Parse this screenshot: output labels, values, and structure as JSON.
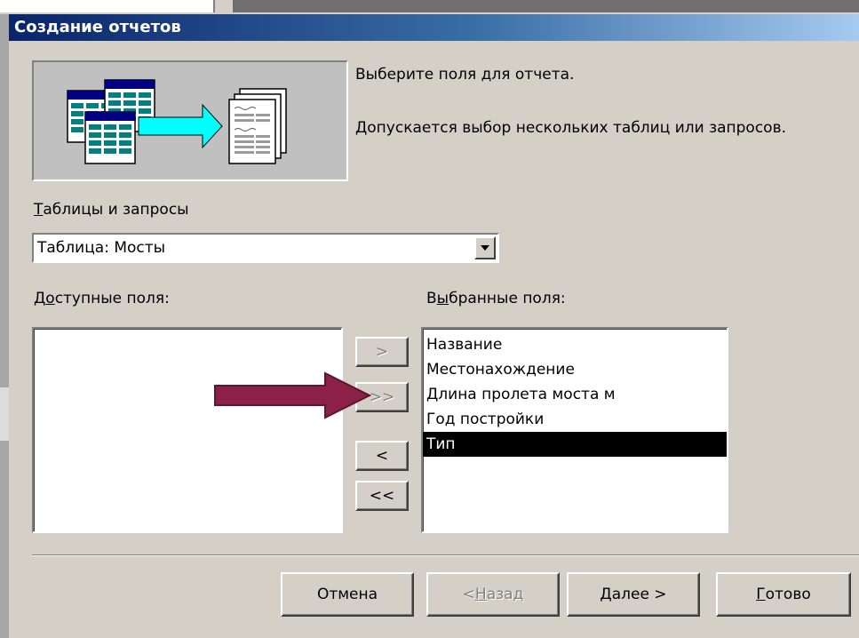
{
  "window": {
    "title": "Создание отчетов"
  },
  "intro": {
    "line1": "Выберите поля для отчета.",
    "line2": "Допускается выбор нескольких таблиц или запросов."
  },
  "tables": {
    "label_hotkey": "Т",
    "label_rest": "аблицы и запросы",
    "selected": "Таблица: Мосты"
  },
  "available": {
    "label_pre": "Д",
    "label_hotkey": "о",
    "label_rest": "ступные поля:",
    "items": []
  },
  "selected_fields": {
    "label_pre": "В",
    "label_hotkey": "ы",
    "label_rest": "бранные поля:",
    "items": [
      "Название",
      "Местонахождение",
      "Длина пролета моста м",
      "Год постройки",
      "Тип"
    ],
    "selected_item": "Тип"
  },
  "move_buttons": {
    "add_one": ">",
    "add_all": ">>",
    "remove_one": "<",
    "remove_all": "<<"
  },
  "footer": {
    "cancel": "Отмена",
    "back_pre": "< ",
    "back_hotkey": "Н",
    "back_rest": "азад",
    "next_hotkey": "Д",
    "next_rest": "алее >",
    "finish_hotkey": "Г",
    "finish_rest": "отово"
  },
  "colors": {
    "dialog_bg": "#d4d0c8",
    "title_start": "#0a246a",
    "title_end": "#a6caf0",
    "arrow": "#8b2146",
    "selection": "#000000"
  }
}
